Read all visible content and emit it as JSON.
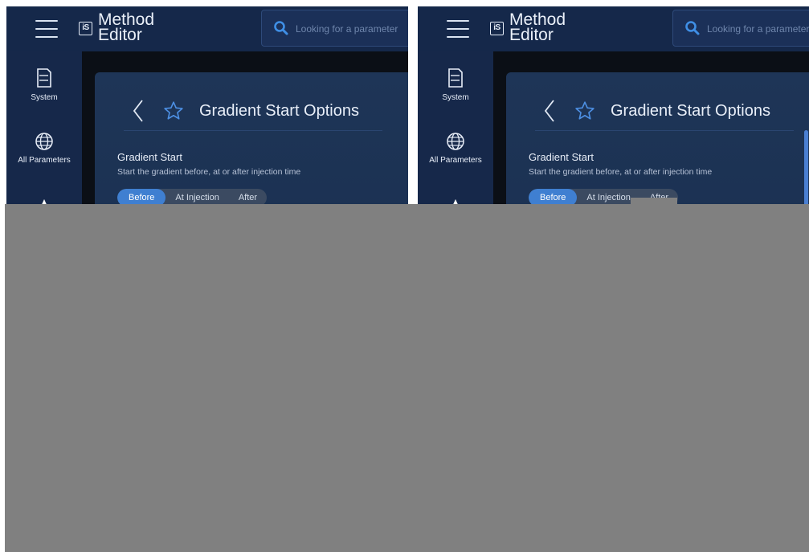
{
  "panels": [
    {
      "app": {
        "title_line1": "Method",
        "title_line2": "Editor",
        "logo_text": "iS"
      },
      "search": {
        "placeholder": "Looking for a parameter"
      },
      "sidebar": {
        "items": [
          {
            "label": "System"
          },
          {
            "label": "All Parameters"
          },
          {
            "label": ""
          }
        ]
      },
      "card": {
        "title": "Gradient Start Options",
        "section_title": "Gradient Start",
        "section_desc": "Start the gradient before, at or after injection time",
        "options": [
          {
            "label": "Before",
            "selected": true
          },
          {
            "label": "At Injection"
          },
          {
            "label": "After"
          }
        ]
      }
    },
    {
      "app": {
        "title_line1": "Method",
        "title_line2": "Editor",
        "logo_text": "iS"
      },
      "search": {
        "placeholder": "Looking for a parameter"
      },
      "sidebar": {
        "items": [
          {
            "label": "System"
          },
          {
            "label": "All Parameters"
          },
          {
            "label": ""
          }
        ]
      },
      "card": {
        "title": "Gradient Start Options",
        "section_title": "Gradient Start",
        "section_desc": "Start the gradient before, at or after injection time",
        "options": [
          {
            "label": "Before",
            "selected": true
          },
          {
            "label": "At Injection"
          },
          {
            "label": "After"
          }
        ]
      }
    }
  ],
  "colors": {
    "topbar": "#15284a",
    "sidebar": "#16284a",
    "accent": "#3f7fd1",
    "redaction": "#808080"
  }
}
